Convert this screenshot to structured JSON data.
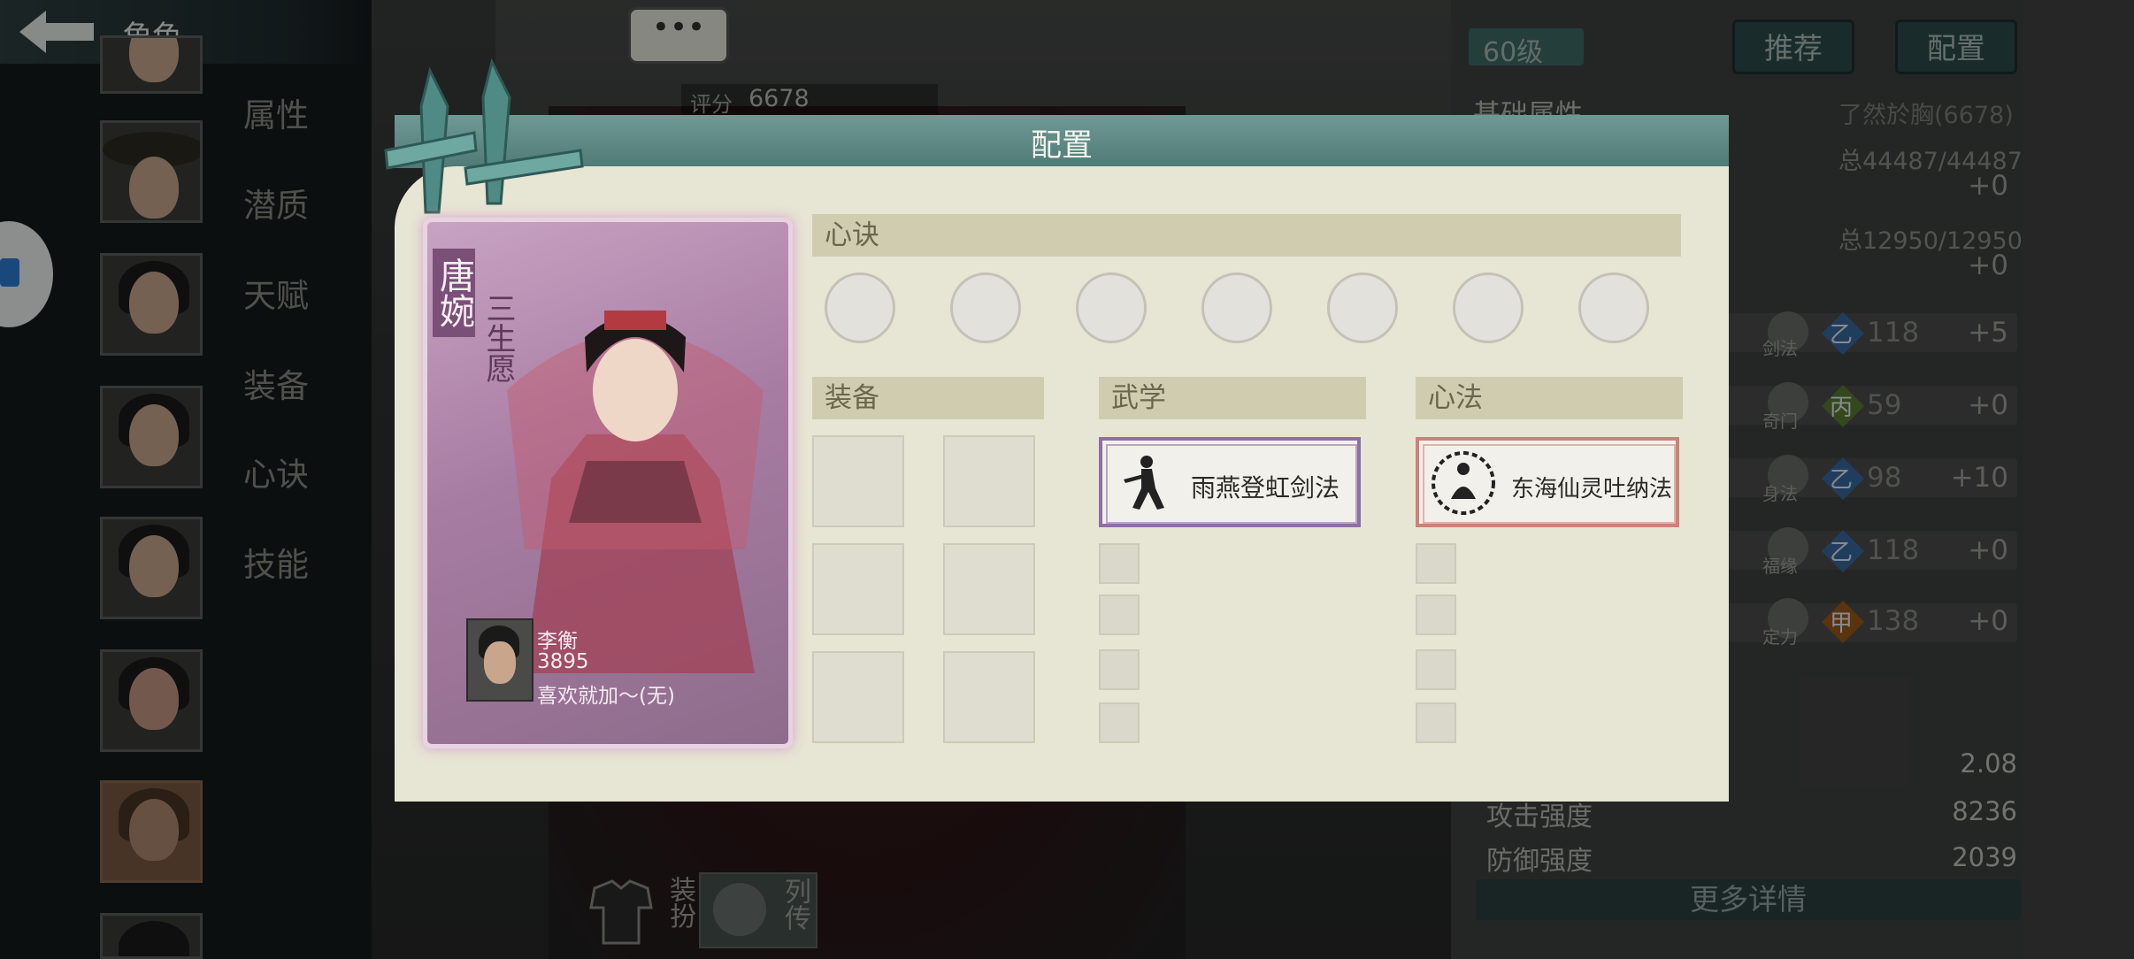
{
  "topbar": {
    "title": "角色"
  },
  "menu": {
    "items": [
      "属性",
      "潜质",
      "天赋",
      "装备",
      "心诀",
      "技能"
    ]
  },
  "bubble": {
    "text": "•••"
  },
  "score": {
    "label": "评分",
    "value": "6678"
  },
  "right": {
    "level": "60级",
    "recommend_label": "推荐",
    "config_label": "配置",
    "basic_attr": "基础属性",
    "eval_text": "了然於胸(6678)",
    "hp_total": "总44487/44487",
    "hp_plus": "+0",
    "mp_total": "总12950/12950",
    "mp_plus": "+0",
    "stats": [
      {
        "name": "剑法",
        "grade": "乙",
        "value": "118",
        "plus": "+5"
      },
      {
        "name": "奇门",
        "grade": "丙",
        "value": "59",
        "plus": "+0"
      },
      {
        "name": "身法",
        "grade": "乙",
        "value": "98",
        "plus": "+10"
      },
      {
        "name": "福缘",
        "grade": "乙",
        "value": "118",
        "plus": "+0"
      },
      {
        "name": "定力",
        "grade": "甲",
        "value": "138",
        "plus": "+0"
      }
    ],
    "lower": [
      {
        "label": "",
        "value": "2.08"
      },
      {
        "label": "攻击强度",
        "value": "8236"
      },
      {
        "label": "防御强度",
        "value": "2039"
      }
    ],
    "more_label": "更多详情"
  },
  "bottom": {
    "dress_label": "装扮",
    "bio_label": "列传"
  },
  "dialog": {
    "title": "配置",
    "card": {
      "name": "唐婉",
      "subtitle": "三生愿",
      "user_name": "李衡",
      "user_score": "3895",
      "user_note": "喜欢就加～(无)"
    },
    "sections": {
      "xinjue": "心诀",
      "equipment": "装备",
      "martial": "武学",
      "heart": "心法"
    },
    "martial_item": "雨燕登虹剑法",
    "heart_item": "东海仙灵吐纳法"
  },
  "colors": {
    "accent": "#4f7a75",
    "dialog_bg": "#e7e5d3",
    "martial_border": "#8f6fa2",
    "heart_border": "#c98378"
  }
}
